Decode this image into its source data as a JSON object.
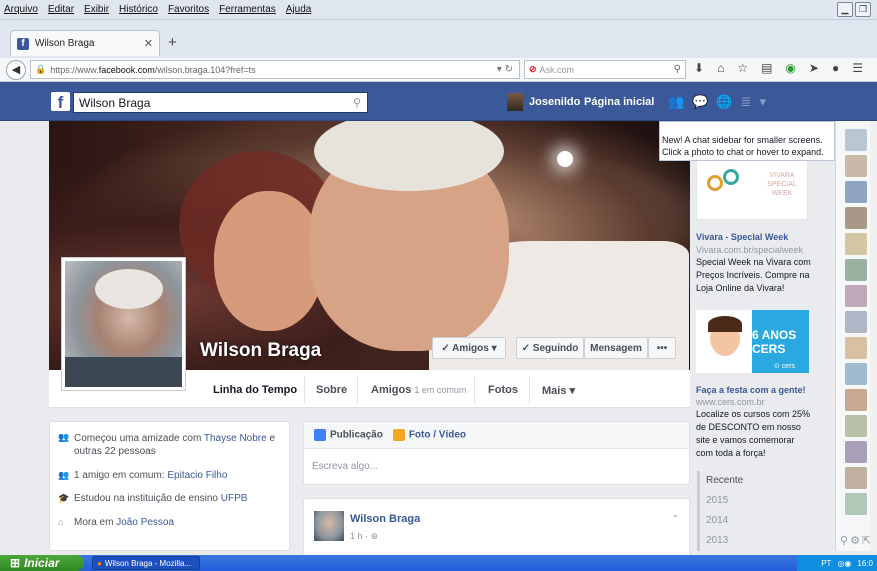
{
  "browser": {
    "menu": [
      "Arquivo",
      "Editar",
      "Exibir",
      "Histórico",
      "Favoritos",
      "Ferramentas",
      "Ajuda"
    ],
    "tab_title": "Wilson Braga",
    "url_prefix": "https://www.",
    "url_domain": "facebook.com",
    "url_path": "/wilson.braga.104?fref=ts",
    "search_engine": "Ask.com"
  },
  "fb": {
    "search_value": "Wilson Braga",
    "user_name": "Josenildo",
    "home_label": "Página inicial"
  },
  "profile": {
    "name": "Wilson Braga",
    "btn_friends": "✓ Amigos ▾",
    "btn_following": "✓ Seguindo",
    "btn_message": "Mensagem",
    "btn_more": "•••",
    "nav": {
      "timeline": "Linha do Tempo",
      "about": "Sobre",
      "friends": "Amigos",
      "friends_mutual": "1 em comum",
      "photos": "Fotos",
      "more": "Mais ▾"
    }
  },
  "intro": {
    "friendship_prefix": "Começou uma amizade com",
    "friendship_name": "Thayse Nobre",
    "friendship_suffix": "e outras 22 pessoas",
    "mutual_prefix": "1 amigo em comum:",
    "mutual_name": "Epitacio Filho",
    "study_prefix": "Estudou na instituição de ensino",
    "study_name": "UFPB",
    "lives_prefix": "Mora em",
    "lives_name": "João Pessoa"
  },
  "composer": {
    "tab_post": "Publicação",
    "tab_photo": "Foto / Vídeo",
    "placeholder": "Escreva algo..."
  },
  "post": {
    "author": "Wilson Braga",
    "time": "1 h · ⊕"
  },
  "chat_tip": "New! A chat sidebar for smaller screens. Click a photo to chat or hover to expand.",
  "ads": [
    {
      "image_text": "VIVARA SPECIAL WEEK",
      "title": "Vivara - Special Week",
      "url": "Vivara.com.br/specialweek",
      "text": "Special Week na Vivara com Preços Incríveis. Compre na Loja Online da Vivara!"
    },
    {
      "image_text": "6 ANOS CERS",
      "image_logo": "⊙ cers",
      "title": "Faça a festa com a gente!",
      "url": "www.cers.com.br",
      "text": "Localize os cursos com 25% de DESCONTO em nosso site e vamos comemorar com toda a força!"
    }
  ],
  "recent": [
    "Recente",
    "2015",
    "2014",
    "2013"
  ],
  "taskbar": {
    "start": "Iniciar",
    "task": "Wilson Braga - Mozilla...",
    "lang": "PT",
    "clock": "16:0"
  },
  "colors": {
    "fb_blue": "#3b5998",
    "link": "#3b5998",
    "muted": "#9197a3"
  }
}
